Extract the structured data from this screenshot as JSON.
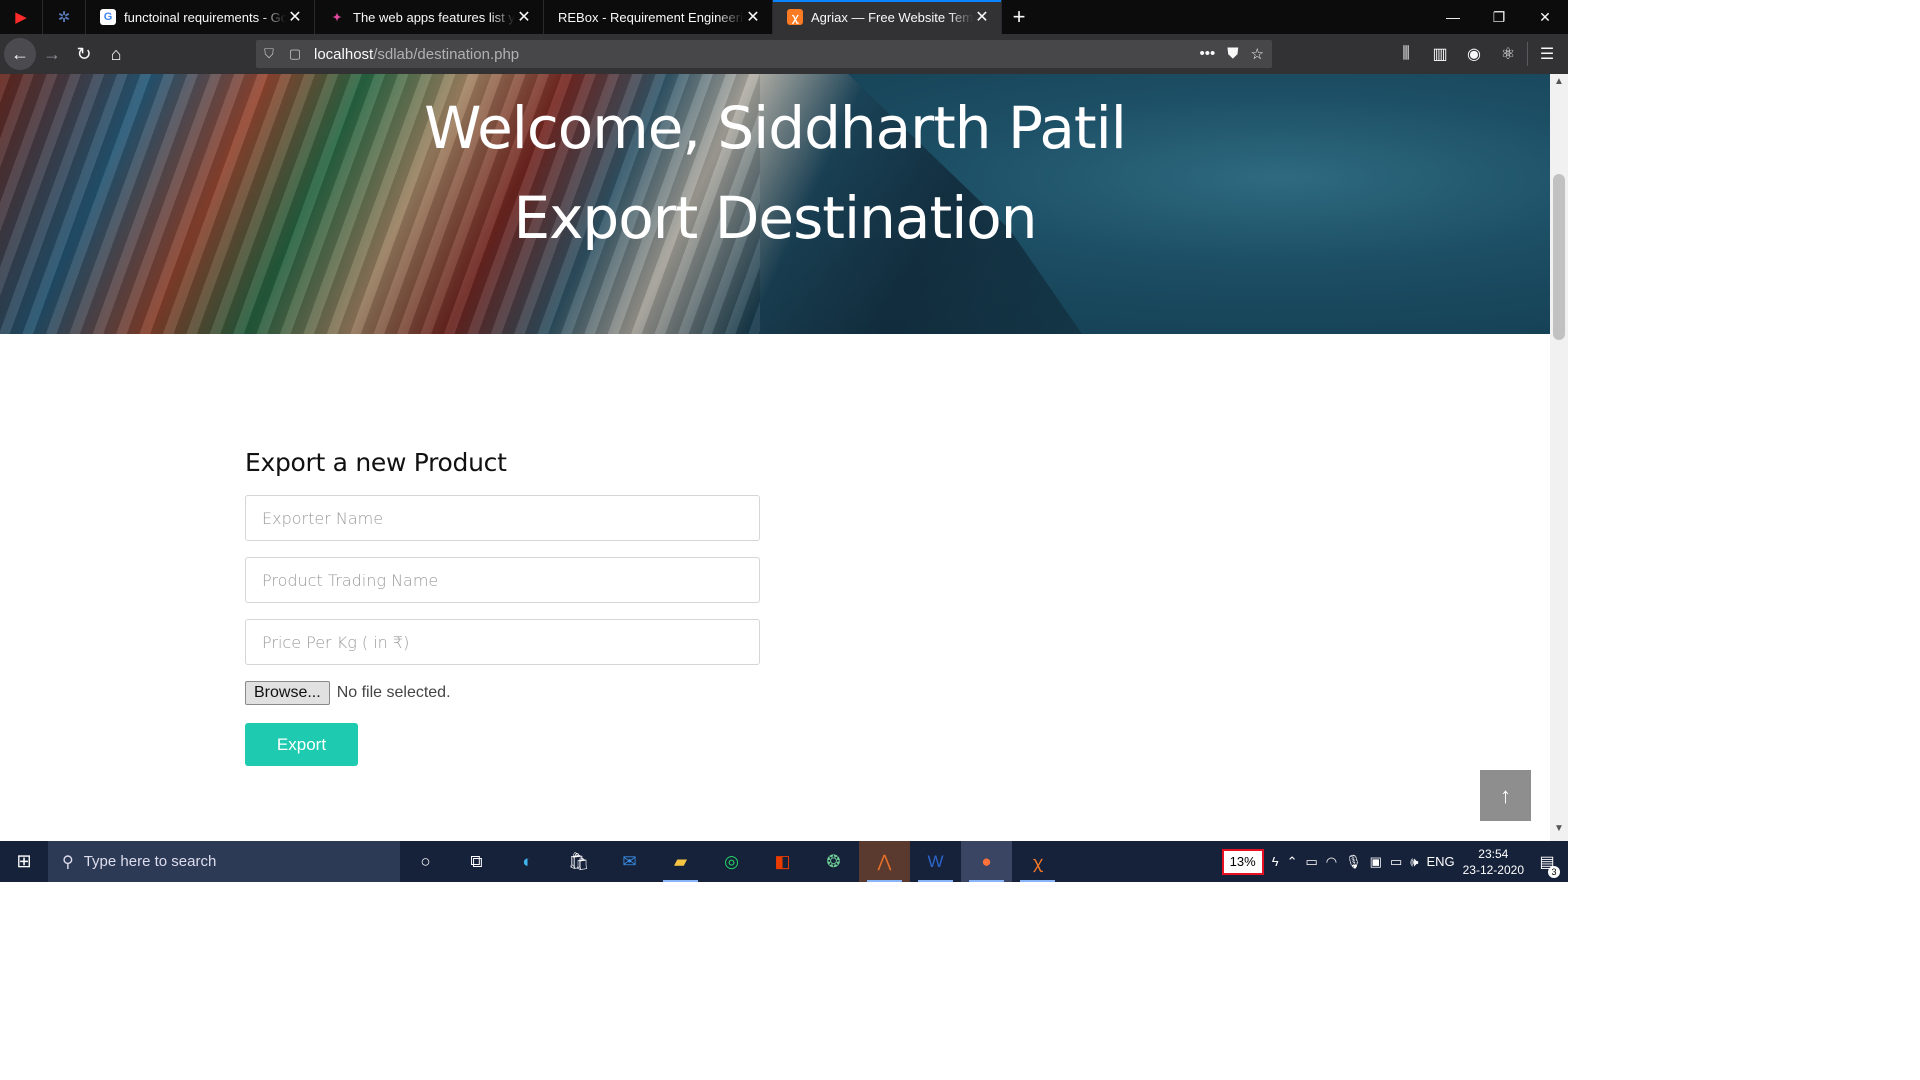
{
  "browser": {
    "tabs": [
      {
        "title": "functoinal requirements - Goo",
        "favicon": "google-icon",
        "favicon_color": "#ffffff"
      },
      {
        "title": "The web apps features list you",
        "favicon": "site-icon",
        "favicon_color": "#e04b9b"
      },
      {
        "title": "REBox - Requirement Engineering",
        "favicon": "",
        "favicon_color": ""
      },
      {
        "title": "Agriax — Free Website Templa",
        "favicon": "xampp-icon",
        "favicon_color": "#fb7a24",
        "active": true
      }
    ],
    "url": {
      "host": "localhost",
      "path": "/sdlab/destination.php"
    }
  },
  "hero": {
    "welcome": "Welcome, Siddharth Patil",
    "subtitle": "Export Destination"
  },
  "form": {
    "title": "Export a new Product",
    "exporter_placeholder": "Exporter Name",
    "product_placeholder": "Product Trading Name",
    "price_placeholder": "Price Per Kg ( in ₹)",
    "browse_label": "Browse...",
    "file_status": "No file selected.",
    "submit_label": "Export",
    "accent_color": "#1ecbb0"
  },
  "taskbar": {
    "search_placeholder": "Type here to search",
    "battery": "13%",
    "language": "ENG",
    "time": "23:54",
    "date": "23-12-2020",
    "notifications": "3"
  }
}
